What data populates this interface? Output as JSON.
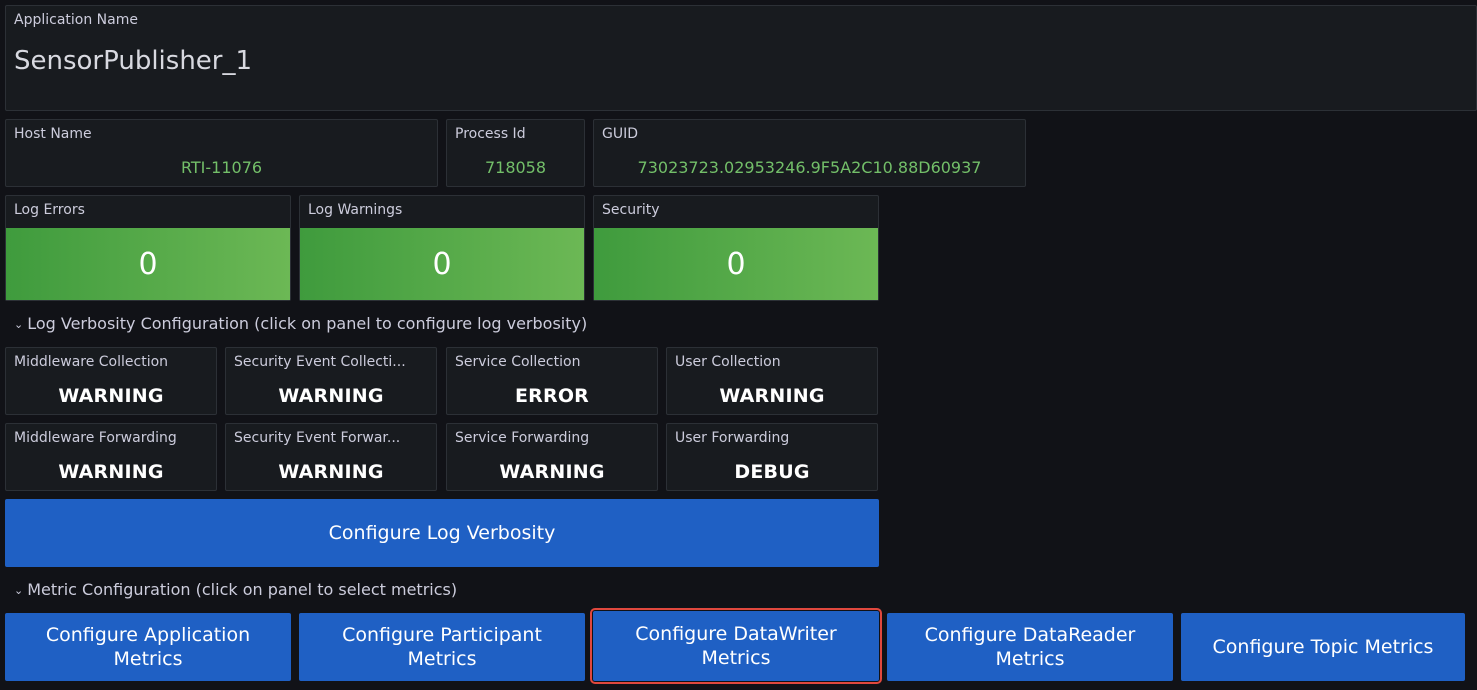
{
  "app": {
    "title": "Application Name",
    "value": "SensorPublisher_1"
  },
  "info": {
    "host": {
      "title": "Host Name",
      "value": "RTI-11076"
    },
    "process": {
      "title": "Process Id",
      "value": "718058"
    },
    "guid": {
      "title": "GUID",
      "value": "73023723.02953246.9F5A2C10.88D60937"
    }
  },
  "stats": {
    "log_errors": {
      "title": "Log Errors",
      "value": "0"
    },
    "log_warnings": {
      "title": "Log Warnings",
      "value": "0"
    },
    "security": {
      "title": "Security",
      "value": "0"
    },
    "status_color": "#56a64b"
  },
  "verbosity_section": {
    "chevron": "⌄",
    "label": "Log Verbosity Configuration (click on panel to configure log verbosity)"
  },
  "verbosity": {
    "collection": [
      {
        "title": "Middleware Collection",
        "value": "WARNING"
      },
      {
        "title": "Security Event Collecti...",
        "value": "WARNING"
      },
      {
        "title": "Service Collection",
        "value": "ERROR"
      },
      {
        "title": "User Collection",
        "value": "WARNING"
      }
    ],
    "forwarding": [
      {
        "title": "Middleware Forwarding",
        "value": "WARNING"
      },
      {
        "title": "Security Event Forwar...",
        "value": "WARNING"
      },
      {
        "title": "Service Forwarding",
        "value": "WARNING"
      },
      {
        "title": "User Forwarding",
        "value": "DEBUG"
      }
    ]
  },
  "configure_log_button": "Configure Log Verbosity",
  "metric_section": {
    "chevron": "⌄",
    "label": "Metric Configuration (click on panel to select metrics)"
  },
  "metric_buttons": [
    {
      "line1": "Configure Application",
      "line2": "Metrics"
    },
    {
      "line1": "Configure Participant",
      "line2": "Metrics"
    },
    {
      "line1": "Configure DataWriter",
      "line2": "Metrics"
    },
    {
      "line1": "Configure DataReader",
      "line2": "Metrics"
    },
    {
      "line1": "Configure Topic Metrics",
      "line2": ""
    }
  ],
  "colors": {
    "button_blue": "#1f60c4",
    "selected_outline": "#e0483e",
    "value_green": "#73bf69"
  }
}
